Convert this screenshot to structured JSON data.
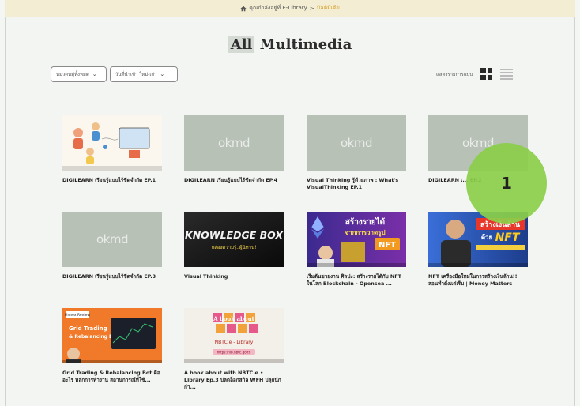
{
  "breadcrumb": {
    "items": [
      "คุณกำลังอยู่ที่ E-Library",
      "มัลติมีเดีย"
    ],
    "separator": ">"
  },
  "header": {
    "title_highlight": "All",
    "title_rest": "Multimedia"
  },
  "filters": {
    "category": {
      "value": "หมวดหมู่ทั้งหมด"
    },
    "sort": {
      "value": "วันที่นำเข้า ใหม่-เก่า"
    }
  },
  "view_toggle": {
    "label": "แสดงรายการแบบ",
    "active": "grid"
  },
  "items": [
    {
      "title": "DIGILEARN เรียนรู้แบบไร้ขีดจำกัด EP.1",
      "thumb": "illustration"
    },
    {
      "title": "DIGILEARN เรียนรู้แบบไร้ขีดจำกัด EP.4",
      "thumb": "placeholder"
    },
    {
      "title": "Visual Thinking รู้ด้วยภาพ : What's VisualThinking EP.1",
      "thumb": "placeholder"
    },
    {
      "title": "DIGILEARN เ... EP.2",
      "thumb": "placeholder"
    },
    {
      "title": "DIGILEARN เรียนรู้แบบไร้ขีดจำกัด EP.3",
      "thumb": "placeholder"
    },
    {
      "title": "Visual Thinking",
      "thumb": "knowledge-box",
      "thumb_text": "KNOWLEDGE BOX",
      "thumb_sub": "กล่องความรู้..ผู้นิทาน!"
    },
    {
      "title": "เริ่มต้นขายงาน ศิลปะ: สร้างรายได้กับ NFT ในโลก Blockchain - Opensea ...",
      "thumb": "nft-art",
      "thumb_text": "สร้างรายได้",
      "thumb_sub": "จากการวาดรูป",
      "thumb_tag": "NFT"
    },
    {
      "title": "NFT เครื่องมือใหม่ในการสร้างเงินล้าน!! สอนทำตั้งแต่เริ่ม | Money Matters",
      "thumb": "nft-money",
      "thumb_text": "สร้างเงินล้าน",
      "thumb_sub": "ด้วย",
      "thumb_tag": "NFT"
    },
    {
      "title": "Grid Trading & Rebalancing Bot คือ อะไร หลักการทำงาน สถานการณ์ที่ใช้...",
      "thumb": "grid-trading",
      "thumb_text": "Grid Trading",
      "thumb_sub": "& Rebalancing Bot",
      "thumb_tag": "Finnex Review"
    },
    {
      "title": "A book about with NBTC e • Library Ep.3 ปลดล็อกสกิล WFH ปลุกนักกำ...",
      "thumb": "abook",
      "thumb_text": "A book about",
      "thumb_sub": "NBTC e - Library",
      "thumb_tag": "https://lib.nbtc.go.th"
    }
  ],
  "placeholder_logo": "okmd",
  "callout": {
    "number": "1"
  },
  "colors": {
    "accent_green": "#8bcf4a",
    "placeholder": "#b7c1b6",
    "breadcrumb_bg": "#f3edd3",
    "breadcrumb_current": "#d4a12a"
  }
}
